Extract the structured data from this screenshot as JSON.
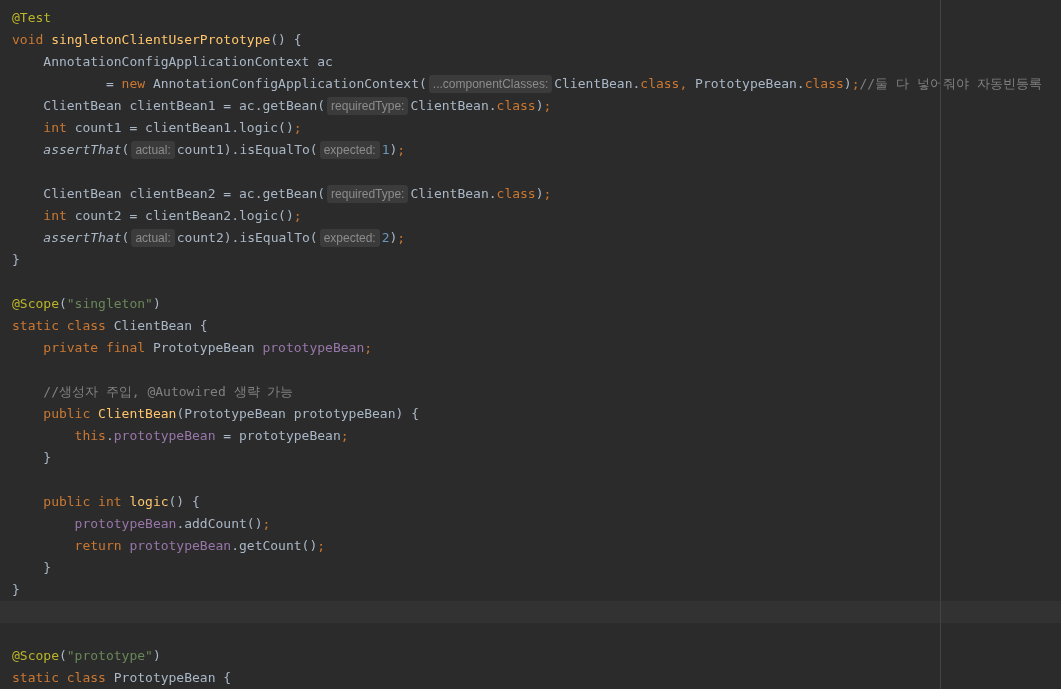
{
  "editor": {
    "lines": [
      {
        "kind": "code",
        "tokens": [
          {
            "kind": "ann",
            "t": "@Test"
          }
        ]
      },
      {
        "kind": "code",
        "tokens": [
          {
            "kind": "kw",
            "t": "void "
          },
          {
            "kind": "decl",
            "t": "singletonClientUserPrototype"
          },
          {
            "kind": "plain",
            "t": "() {"
          }
        ]
      },
      {
        "kind": "code",
        "tokens": [
          {
            "kind": "plain",
            "t": "    AnnotationConfigApplicationContext ac"
          }
        ]
      },
      {
        "kind": "code",
        "tokens": [
          {
            "kind": "plain",
            "t": "            = "
          },
          {
            "kind": "kw",
            "t": "new "
          },
          {
            "kind": "plain",
            "t": "AnnotationConfigApplicationContext("
          },
          {
            "kind": "hint",
            "t": "...componentClasses:"
          },
          {
            "kind": "plain",
            "t": "ClientBean."
          },
          {
            "kind": "kw",
            "t": "class"
          },
          {
            "kind": "kw",
            "t": ", "
          },
          {
            "kind": "plain",
            "t": "PrototypeBean."
          },
          {
            "kind": "kw",
            "t": "class"
          },
          {
            "kind": "plain",
            "t": ")"
          },
          {
            "kind": "kw",
            "t": ";"
          },
          {
            "kind": "cmt",
            "t": "//둘 다 넣어줘야 자동빈등록"
          }
        ]
      },
      {
        "kind": "code",
        "tokens": [
          {
            "kind": "plain",
            "t": "    ClientBean clientBean1 = ac.getBean("
          },
          {
            "kind": "hint",
            "t": "requiredType:"
          },
          {
            "kind": "plain",
            "t": "ClientBean."
          },
          {
            "kind": "kw",
            "t": "class"
          },
          {
            "kind": "plain",
            "t": ")"
          },
          {
            "kind": "kw",
            "t": ";"
          }
        ]
      },
      {
        "kind": "code",
        "tokens": [
          {
            "kind": "kw",
            "t": "    int "
          },
          {
            "kind": "plain",
            "t": "count1 = clientBean1.logic()"
          },
          {
            "kind": "kw",
            "t": ";"
          }
        ]
      },
      {
        "kind": "code",
        "tokens": [
          {
            "kind": "ital",
            "t": "    assertThat"
          },
          {
            "kind": "plain",
            "t": "("
          },
          {
            "kind": "hint",
            "t": "actual:"
          },
          {
            "kind": "plain",
            "t": "count1).isEqualTo("
          },
          {
            "kind": "hint",
            "t": "expected:"
          },
          {
            "kind": "num",
            "t": "1"
          },
          {
            "kind": "plain",
            "t": ")"
          },
          {
            "kind": "kw",
            "t": ";"
          }
        ]
      },
      {
        "kind": "code"
      },
      {
        "kind": "code",
        "tokens": [
          {
            "kind": "plain",
            "t": "    ClientBean clientBean2 = ac.getBean("
          },
          {
            "kind": "hint",
            "t": "requiredType:"
          },
          {
            "kind": "plain",
            "t": "ClientBean."
          },
          {
            "kind": "kw",
            "t": "class"
          },
          {
            "kind": "plain",
            "t": ")"
          },
          {
            "kind": "kw",
            "t": ";"
          }
        ]
      },
      {
        "kind": "code",
        "tokens": [
          {
            "kind": "kw",
            "t": "    int "
          },
          {
            "kind": "plain",
            "t": "count2 = clientBean2.logic()"
          },
          {
            "kind": "kw",
            "t": ";"
          }
        ]
      },
      {
        "kind": "code",
        "tokens": [
          {
            "kind": "ital",
            "t": "    assertThat"
          },
          {
            "kind": "plain",
            "t": "("
          },
          {
            "kind": "hint",
            "t": "actual:"
          },
          {
            "kind": "plain",
            "t": "count2).isEqualTo("
          },
          {
            "kind": "hint",
            "t": "expected:"
          },
          {
            "kind": "num",
            "t": "2"
          },
          {
            "kind": "plain",
            "t": ")"
          },
          {
            "kind": "kw",
            "t": ";"
          }
        ]
      },
      {
        "kind": "code",
        "tokens": [
          {
            "kind": "plain",
            "t": "}"
          }
        ]
      },
      {
        "kind": "code"
      },
      {
        "kind": "code",
        "tokens": [
          {
            "kind": "ann",
            "t": "@Scope"
          },
          {
            "kind": "plain",
            "t": "("
          },
          {
            "kind": "str",
            "t": "\"singleton\""
          },
          {
            "kind": "plain",
            "t": ")"
          }
        ]
      },
      {
        "kind": "code",
        "tokens": [
          {
            "kind": "kw",
            "t": "static class "
          },
          {
            "kind": "plain",
            "t": "ClientBean {"
          }
        ]
      },
      {
        "kind": "code",
        "tokens": [
          {
            "kind": "kw",
            "t": "    private final "
          },
          {
            "kind": "plain",
            "t": "PrototypeBean "
          },
          {
            "kind": "field",
            "t": "prototypeBean"
          },
          {
            "kind": "kw",
            "t": ";"
          }
        ]
      },
      {
        "kind": "code"
      },
      {
        "kind": "code",
        "tokens": [
          {
            "kind": "cmt",
            "t": "    //생성자 주입, @Autowired 생략 가능"
          }
        ]
      },
      {
        "kind": "code",
        "tokens": [
          {
            "kind": "kw",
            "t": "    public "
          },
          {
            "kind": "decl",
            "t": "ClientBean"
          },
          {
            "kind": "plain",
            "t": "(PrototypeBean prototypeBean) {"
          }
        ]
      },
      {
        "kind": "code",
        "tokens": [
          {
            "kind": "kw",
            "t": "        this"
          },
          {
            "kind": "plain",
            "t": "."
          },
          {
            "kind": "field",
            "t": "prototypeBean"
          },
          {
            "kind": "plain",
            "t": " = prototypeBean"
          },
          {
            "kind": "kw",
            "t": ";"
          }
        ]
      },
      {
        "kind": "code",
        "tokens": [
          {
            "kind": "plain",
            "t": "    }"
          }
        ]
      },
      {
        "kind": "code"
      },
      {
        "kind": "code",
        "tokens": [
          {
            "kind": "kw",
            "t": "    public int "
          },
          {
            "kind": "decl",
            "t": "logic"
          },
          {
            "kind": "plain",
            "t": "() {"
          }
        ]
      },
      {
        "kind": "code",
        "tokens": [
          {
            "kind": "field",
            "t": "        prototypeBean"
          },
          {
            "kind": "plain",
            "t": ".addCount()"
          },
          {
            "kind": "kw",
            "t": ";"
          }
        ]
      },
      {
        "kind": "code",
        "tokens": [
          {
            "kind": "kw",
            "t": "        return "
          },
          {
            "kind": "field",
            "t": "prototypeBean"
          },
          {
            "kind": "plain",
            "t": ".getCount()"
          },
          {
            "kind": "kw",
            "t": ";"
          }
        ]
      },
      {
        "kind": "code",
        "tokens": [
          {
            "kind": "plain",
            "t": "    }"
          }
        ]
      },
      {
        "kind": "code",
        "tokens": [
          {
            "kind": "plain",
            "t": "}"
          }
        ]
      },
      {
        "kind": "current"
      },
      {
        "kind": "code"
      },
      {
        "kind": "code",
        "tokens": [
          {
            "kind": "ann",
            "t": "@Scope"
          },
          {
            "kind": "plain",
            "t": "("
          },
          {
            "kind": "str",
            "t": "\"prototype\""
          },
          {
            "kind": "plain",
            "t": ")"
          }
        ]
      },
      {
        "kind": "code",
        "tokens": [
          {
            "kind": "kw",
            "t": "static class "
          },
          {
            "kind": "plain",
            "t": "PrototypeBean {"
          }
        ]
      }
    ]
  }
}
